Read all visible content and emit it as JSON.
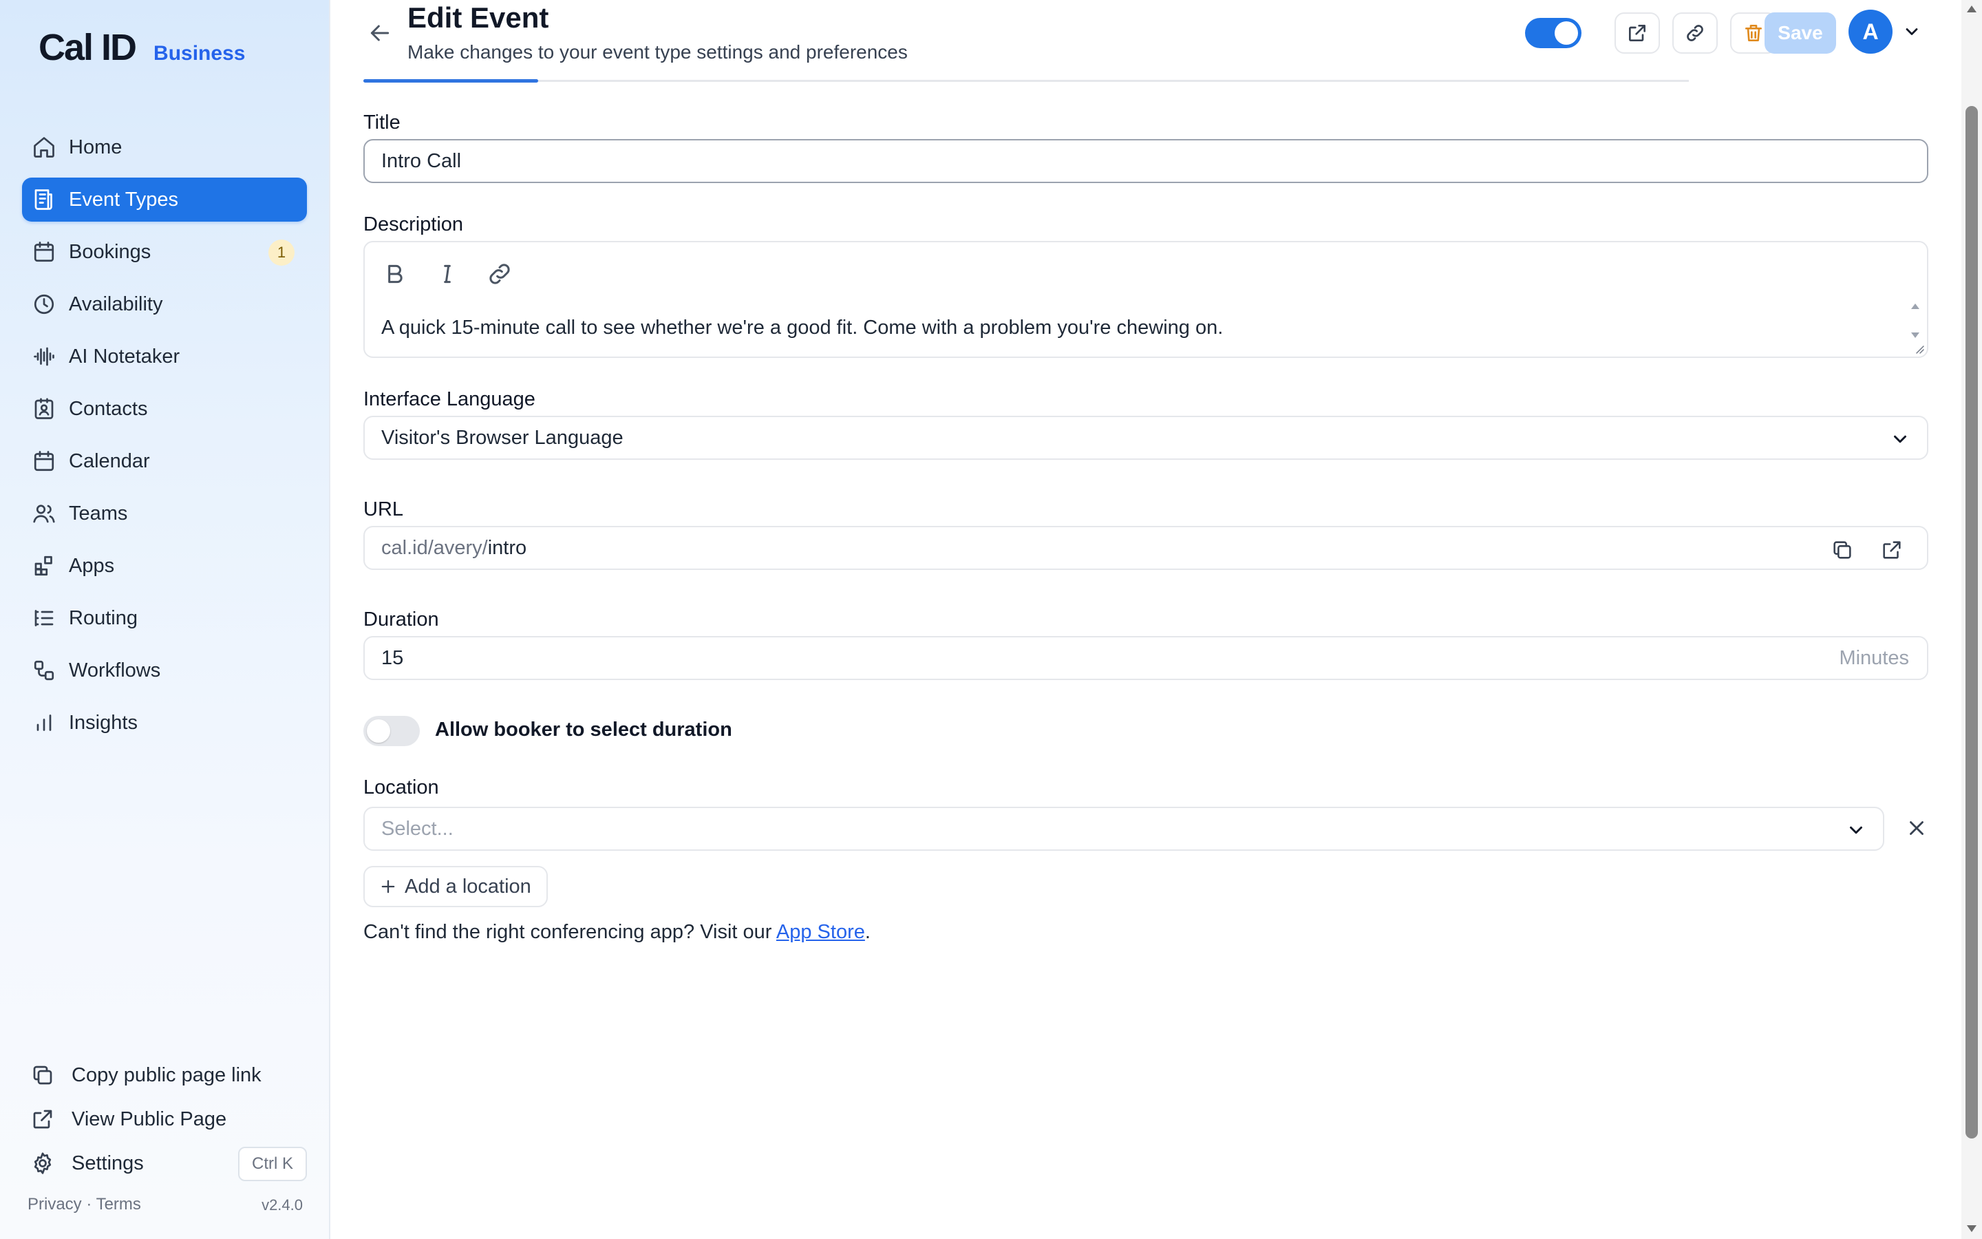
{
  "brand": {
    "logo": "Cal ID",
    "tier": "Business",
    "accent": "#1f74e6"
  },
  "sidebar": {
    "items": [
      {
        "label": "Home",
        "icon": "home-icon"
      },
      {
        "label": "Event Types",
        "icon": "event-types-icon",
        "active": true
      },
      {
        "label": "Bookings",
        "icon": "calendar-icon",
        "badge": "1"
      },
      {
        "label": "Availability",
        "icon": "clock-icon"
      },
      {
        "label": "AI Notetaker",
        "icon": "waveform-icon"
      },
      {
        "label": "Contacts",
        "icon": "contacts-icon"
      },
      {
        "label": "Calendar",
        "icon": "calendar-icon"
      },
      {
        "label": "Teams",
        "icon": "users-icon"
      },
      {
        "label": "Apps",
        "icon": "apps-grid-icon"
      },
      {
        "label": "Routing",
        "icon": "routing-icon"
      },
      {
        "label": "Workflows",
        "icon": "workflow-icon"
      },
      {
        "label": "Insights",
        "icon": "bar-chart-icon"
      }
    ],
    "bottom": {
      "copy_link": "Copy public page link",
      "view_public": "View Public Page",
      "settings": "Settings",
      "shortcut": "Ctrl K"
    },
    "legal": "Privacy · Terms",
    "version": "v2.4.0"
  },
  "header": {
    "title": "Edit Event",
    "subtitle": "Make changes to your event type settings and preferences",
    "save_label": "Save",
    "avatar_initial": "A"
  },
  "form": {
    "title_label": "Title",
    "title_value": "Intro Call",
    "description_label": "Description",
    "description_value": "A quick 15-minute call to see whether we're a good fit. Come with a problem you're chewing on.",
    "language_label": "Interface Language",
    "language_value": "Visitor's Browser Language",
    "url_label": "URL",
    "url_prefix": "cal.id/avery/",
    "url_slug": "intro",
    "duration_label": "Duration",
    "duration_value": "15",
    "duration_suffix": "Minutes",
    "allow_duration_label": "Allow booker to select duration",
    "location_label": "Location",
    "location_placeholder": "Select...",
    "add_location_label": "Add a location",
    "help_prefix": "Can't find the right conferencing app? Visit our ",
    "help_link": "App Store",
    "help_suffix": "."
  }
}
